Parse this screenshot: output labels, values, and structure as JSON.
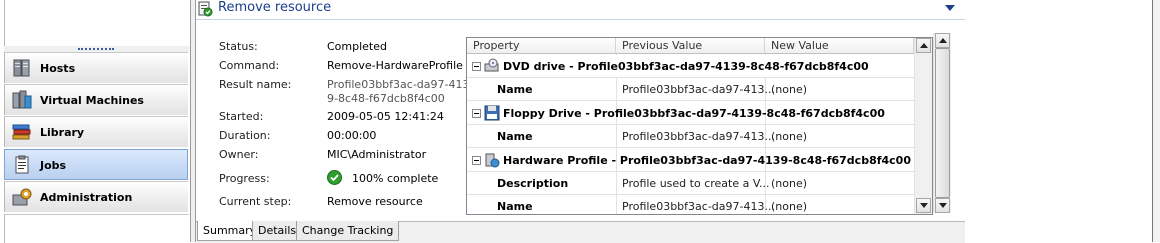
{
  "nav": {
    "items": [
      {
        "label": "Hosts",
        "icon": "hosts-icon"
      },
      {
        "label": "Virtual Machines",
        "icon": "virtual-machines-icon"
      },
      {
        "label": "Library",
        "icon": "library-icon"
      },
      {
        "label": "Jobs",
        "icon": "jobs-icon"
      },
      {
        "label": "Administration",
        "icon": "administration-icon"
      }
    ],
    "active": "Jobs"
  },
  "detail": {
    "title": "Remove resource",
    "fields": [
      {
        "label": "Status:",
        "value": "Completed"
      },
      {
        "label": "Command:",
        "value": "Remove-HardwareProfile"
      },
      {
        "label": "Result name:",
        "value": "Profile03bbf3ac-da97-413",
        "value2": "9-8c48-f67dcb8f4c00"
      },
      {
        "label": "Started:",
        "value": "2009-05-05 12:41:24"
      },
      {
        "label": "Duration:",
        "value": "00:00:00"
      },
      {
        "label": "Owner:",
        "value": "MIC\\Administrator"
      },
      {
        "label": "Progress:",
        "value": "100% complete"
      },
      {
        "label": "Current step:",
        "value": "Remove resource"
      }
    ]
  },
  "grid": {
    "columns": [
      "Property",
      "Previous Value",
      "New Value"
    ],
    "groups": [
      {
        "title": "DVD drive - Profile03bbf3ac-da97-4139-8c48-f67dcb8f4c00",
        "icon": "dvd-drive-icon",
        "rows": [
          {
            "property": "Name",
            "previous": "Profile03bbf3ac-da97-413...",
            "new": "(none)"
          }
        ]
      },
      {
        "title": "Floppy Drive - Profile03bbf3ac-da97-4139-8c48-f67dcb8f4c00",
        "icon": "floppy-drive-icon",
        "rows": [
          {
            "property": "Name",
            "previous": "Profile03bbf3ac-da97-413...",
            "new": "(none)"
          }
        ]
      },
      {
        "title": "Hardware Profile - Profile03bbf3ac-da97-4139-8c48-f67dcb8f4c00",
        "icon": "hardware-profile-icon",
        "rows": [
          {
            "property": "Description",
            "previous": "Profile used to create a V...",
            "new": "(none)"
          },
          {
            "property": "Name",
            "previous": "Profile03bbf3ac-da97-413...",
            "new": "(none)"
          }
        ]
      }
    ]
  },
  "tabs": [
    {
      "label": "Summary",
      "active": true
    },
    {
      "label": "Details",
      "active": false
    },
    {
      "label": "Change Tracking",
      "active": false
    }
  ],
  "colors": {
    "title_blue": "#1b3f8b",
    "nav_active": "#c9dcf6",
    "progress_ok": "#2f9e2f"
  }
}
